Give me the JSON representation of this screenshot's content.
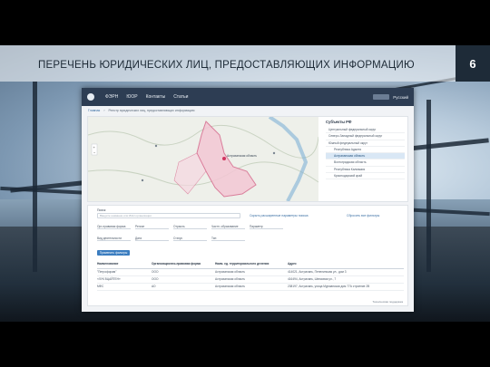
{
  "slide": {
    "title": "ПЕРЕЧЕНЬ ЮРИДИЧЕСКИХ ЛИЦ, ПРЕДОСТАВЛЯЮЩИХ ИНФОРМАЦИЮ",
    "page_number": "6"
  },
  "colors": {
    "navbar": "#2d3d53",
    "accent": "#3b7dc0",
    "region_highlight": "#d9e7f5",
    "badge": "#1e2b38"
  },
  "app": {
    "nav": [
      "ФЭРН",
      "ЮОР",
      "Контакты",
      "Статьи"
    ],
    "lang_label": "Русский",
    "breadcrumb": [
      "Главная",
      "Реестр юридических лиц, предоставляющих информацию"
    ],
    "map": {
      "marker_label": "Астраханская область"
    },
    "regions": {
      "title": "Субъекты РФ",
      "items": [
        {
          "label": "Центральный федеральный округ",
          "sub": false,
          "active": false
        },
        {
          "label": "Северо-Западный федеральный округ",
          "sub": false,
          "active": false
        },
        {
          "label": "Южный федеральный округ",
          "sub": false,
          "active": false
        },
        {
          "label": "Республика Адыгея",
          "sub": true,
          "active": false
        },
        {
          "label": "Астраханская область",
          "sub": true,
          "active": true
        },
        {
          "label": "Волгоградская область",
          "sub": true,
          "active": false
        },
        {
          "label": "Республика Калмыкия",
          "sub": true,
          "active": false
        },
        {
          "label": "Краснодарский край",
          "sub": true,
          "active": false
        }
      ]
    },
    "filters": {
      "search_label": "Поиск",
      "search_placeholder": "Введите название или ИНН организации",
      "advanced_link": "Скрыть расширенные параметры поиска",
      "reset_link": "Сбросить все фильтры",
      "row1": [
        "Орг-правовая форма",
        "Регион",
        "Отрасль",
        "Частн. образование",
        "Параметр"
      ],
      "row2": [
        "Вид деятельности",
        "Дата",
        "Статус",
        "Тип"
      ],
      "apply_button": "Применить фильтры"
    },
    "table": {
      "headers": [
        "Наименование",
        "Организационно-правовая форма",
        "Наим. ед. территориального деления",
        "Адрес"
      ],
      "rows": [
        [
          "\"Петрофорам\"",
          "ООО",
          "Астраханская область",
          "414021, Астрахань, Пепелинская ул., дом 3"
        ],
        [
          "«ЛУК ВЦАЙТЕН»",
          "ООО",
          "Астраханская область",
          "416494, Астрахань, Шелковая ул., 7"
        ],
        [
          "МФС",
          "АО",
          "Астраханская область",
          "238197, Астрахань, улица Мурманская дом 77А строение 2В"
        ]
      ]
    },
    "footer_note": "Техническая поддержка"
  }
}
